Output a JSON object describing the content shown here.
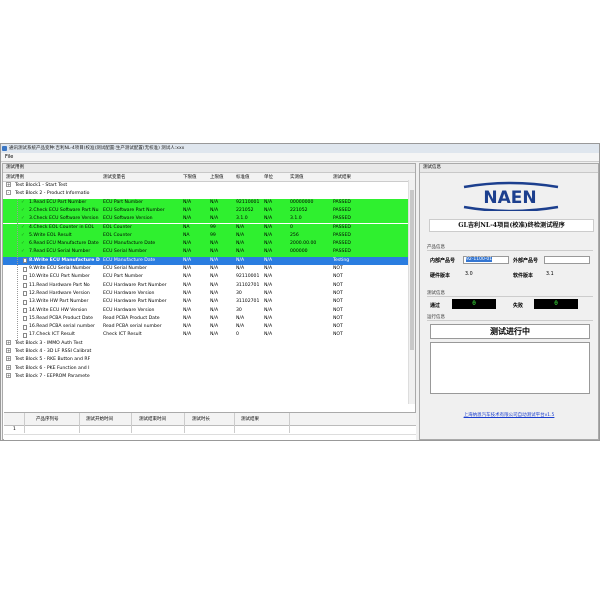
{
  "window": {
    "title": "通讯测试系统产品变种:吉利NL-4项目(校准)测试配置:生产测试配置(无校准) 测试人:xxx"
  },
  "menu": {
    "file": "File"
  },
  "left_panel": {
    "title": "测试用例",
    "columns": [
      "测试用例",
      "测试变量名",
      "下限值",
      "上限值",
      "标准值",
      "单位",
      "实测值",
      "测试结果"
    ]
  },
  "tree_rows": [
    {
      "kind": "block",
      "expander": "+",
      "name": "Test Block1 - Start Test"
    },
    {
      "kind": "block",
      "expander": "-",
      "name": "Test Block 2 - Product Informatio"
    },
    {
      "kind": "item",
      "state": "passed",
      "mark": "✓",
      "name": "1.Read ECU Part Number",
      "var": "ECU Part Number",
      "low": "N/A",
      "high": "N/A",
      "std": "92110001",
      "unit": "N/A",
      "meas": "00000000",
      "result": "PASSED"
    },
    {
      "kind": "item",
      "state": "passed",
      "mark": "✓",
      "name": "2.Check ECU Software Part Nu",
      "var": "ECU Software Part Number",
      "low": "N/A",
      "high": "N/A",
      "std": "221052",
      "unit": "N/A",
      "meas": "221052",
      "result": "PASSED"
    },
    {
      "kind": "item",
      "state": "passed",
      "mark": "✓",
      "name": "3.Check ECU Software Version",
      "var": "ECU Software Version",
      "low": "N/A",
      "high": "N/A",
      "std": "3.1.0",
      "unit": "N/A",
      "meas": "3.1.0",
      "result": "PASSED"
    },
    {
      "kind": "item",
      "state": "passed",
      "mark": "✓",
      "name": "4.Check EOL Counter in EOL",
      "var": "EOL Counter",
      "low": "NA",
      "high": "99",
      "std": "N/A",
      "unit": "N/A",
      "meas": "0",
      "result": "PASSED"
    },
    {
      "kind": "item",
      "state": "passed",
      "mark": "✓",
      "name": "5.Write EOL Result",
      "var": "EOL Counter",
      "low": "NA",
      "high": "99",
      "std": "N/A",
      "unit": "N/A",
      "meas": "256",
      "result": "PASSED"
    },
    {
      "kind": "item",
      "state": "passed",
      "mark": "✓",
      "name": "6.Read ECU Manufacture Date",
      "var": "ECU Manufacture Date",
      "low": "N/A",
      "high": "N/A",
      "std": "N/A",
      "unit": "N/A",
      "meas": "2000.00.00",
      "result": "PASSED"
    },
    {
      "kind": "item",
      "state": "passed",
      "mark": "✓",
      "name": "7.Read ECU Serial Number",
      "var": "ECU Serial Number",
      "low": "N/A",
      "high": "N/A",
      "std": "N/A",
      "unit": "N/A",
      "meas": "000000",
      "result": "PASSED"
    },
    {
      "kind": "item",
      "state": "testing",
      "mark": "",
      "name": "8.Write ECU Manufacture D",
      "var": "ECU Manufacture Date",
      "low": "N/A",
      "high": "N/A",
      "std": "N/A",
      "unit": "N/A",
      "meas": "",
      "result": "Testing"
    },
    {
      "kind": "item",
      "state": "none",
      "mark": "",
      "name": "9.Write ECU Serial Number",
      "var": "ECU Serial Number",
      "low": "N/A",
      "high": "N/A",
      "std": "N/A",
      "unit": "N/A",
      "meas": "",
      "result": "NOT"
    },
    {
      "kind": "item",
      "state": "none",
      "mark": "",
      "name": "10.Write ECU Part Number",
      "var": "ECU Part Number",
      "low": "N/A",
      "high": "N/A",
      "std": "92110001",
      "unit": "N/A",
      "meas": "",
      "result": "NOT"
    },
    {
      "kind": "item",
      "state": "none",
      "mark": "",
      "name": "11.Read Hardware Part No",
      "var": "ECU Hardware Part Number",
      "low": "N/A",
      "high": "N/A",
      "std": "31102701",
      "unit": "N/A",
      "meas": "",
      "result": "NOT"
    },
    {
      "kind": "item",
      "state": "none",
      "mark": "",
      "name": "12.Read Hardware Version",
      "var": "ECU Hardware Version",
      "low": "N/A",
      "high": "N/A",
      "std": "30",
      "unit": "N/A",
      "meas": "",
      "result": "NOT"
    },
    {
      "kind": "item",
      "state": "none",
      "mark": "",
      "name": "13.Write HW Part Number",
      "var": "ECU Hardware Part Number",
      "low": "N/A",
      "high": "N/A",
      "std": "31102701",
      "unit": "N/A",
      "meas": "",
      "result": "NOT"
    },
    {
      "kind": "item",
      "state": "none",
      "mark": "",
      "name": "14.Write ECU HW Version",
      "var": "ECU Hardware Version",
      "low": "N/A",
      "high": "N/A",
      "std": "30",
      "unit": "N/A",
      "meas": "",
      "result": "NOT"
    },
    {
      "kind": "item",
      "state": "none",
      "mark": "",
      "name": "15.Read PCBA Product Date",
      "var": "Read PCBA Product Date",
      "low": "N/A",
      "high": "N/A",
      "std": "N/A",
      "unit": "N/A",
      "meas": "",
      "result": "NOT"
    },
    {
      "kind": "item",
      "state": "none",
      "mark": "",
      "name": "16.Read PCBA serial number",
      "var": "Read PCBA serial number",
      "low": "N/A",
      "high": "N/A",
      "std": "N/A",
      "unit": "N/A",
      "meas": "",
      "result": "NOT"
    },
    {
      "kind": "item",
      "state": "none",
      "mark": "",
      "name": "17.Check ICT Result",
      "var": "Check ICT Result",
      "low": "N/A",
      "high": "N/A",
      "std": "0",
      "unit": "N/A",
      "meas": "",
      "result": "NOT"
    },
    {
      "kind": "block",
      "expander": "+",
      "name": "Test Block 3 - IMMO Auth Test"
    },
    {
      "kind": "block",
      "expander": "+",
      "name": "Test Block 4 - 3D LF RSSI Calibrat"
    },
    {
      "kind": "block",
      "expander": "+",
      "name": "Test Block 5 - RKE Button and RF"
    },
    {
      "kind": "block",
      "expander": "+",
      "name": "Test Block 6 - PKE Function and I"
    },
    {
      "kind": "block",
      "expander": "+",
      "name": "Test Block 7 - EEPROM Paramete"
    }
  ],
  "bottom_table": {
    "columns": [
      "产品序列号",
      "测试开始时间",
      "测试结束时间",
      "测试时长",
      "测试结果"
    ],
    "rows": [
      {
        "index": "1"
      }
    ]
  },
  "right_panel": {
    "title": "测试信息",
    "logo_text": "NAEN",
    "banner": "GL吉利NL-4项目(校准)终检测试程序",
    "product_section": "产品信息",
    "internal_pn_label": "内部产品号",
    "internal_pn_value": "92-1100-01",
    "external_pn_label": "外部产品号",
    "external_pn_value": "",
    "hw_label": "硬件版本",
    "hw_value": "3.0",
    "sw_label": "软件版本",
    "sw_value": "3.1",
    "test_section": "测试信息",
    "pass_label": "通过",
    "pass_value": "0",
    "fail_label": "失败",
    "fail_value": "0",
    "run_section": "运行信息",
    "running_text": "测试进行中",
    "footer_link": "上海纳恩汽车技术有限公司自动测试平台v1.5"
  },
  "colors": {
    "passed": "#2ff02f",
    "testing": "#2a7de0",
    "logo_blue": "#1c3f8e"
  }
}
